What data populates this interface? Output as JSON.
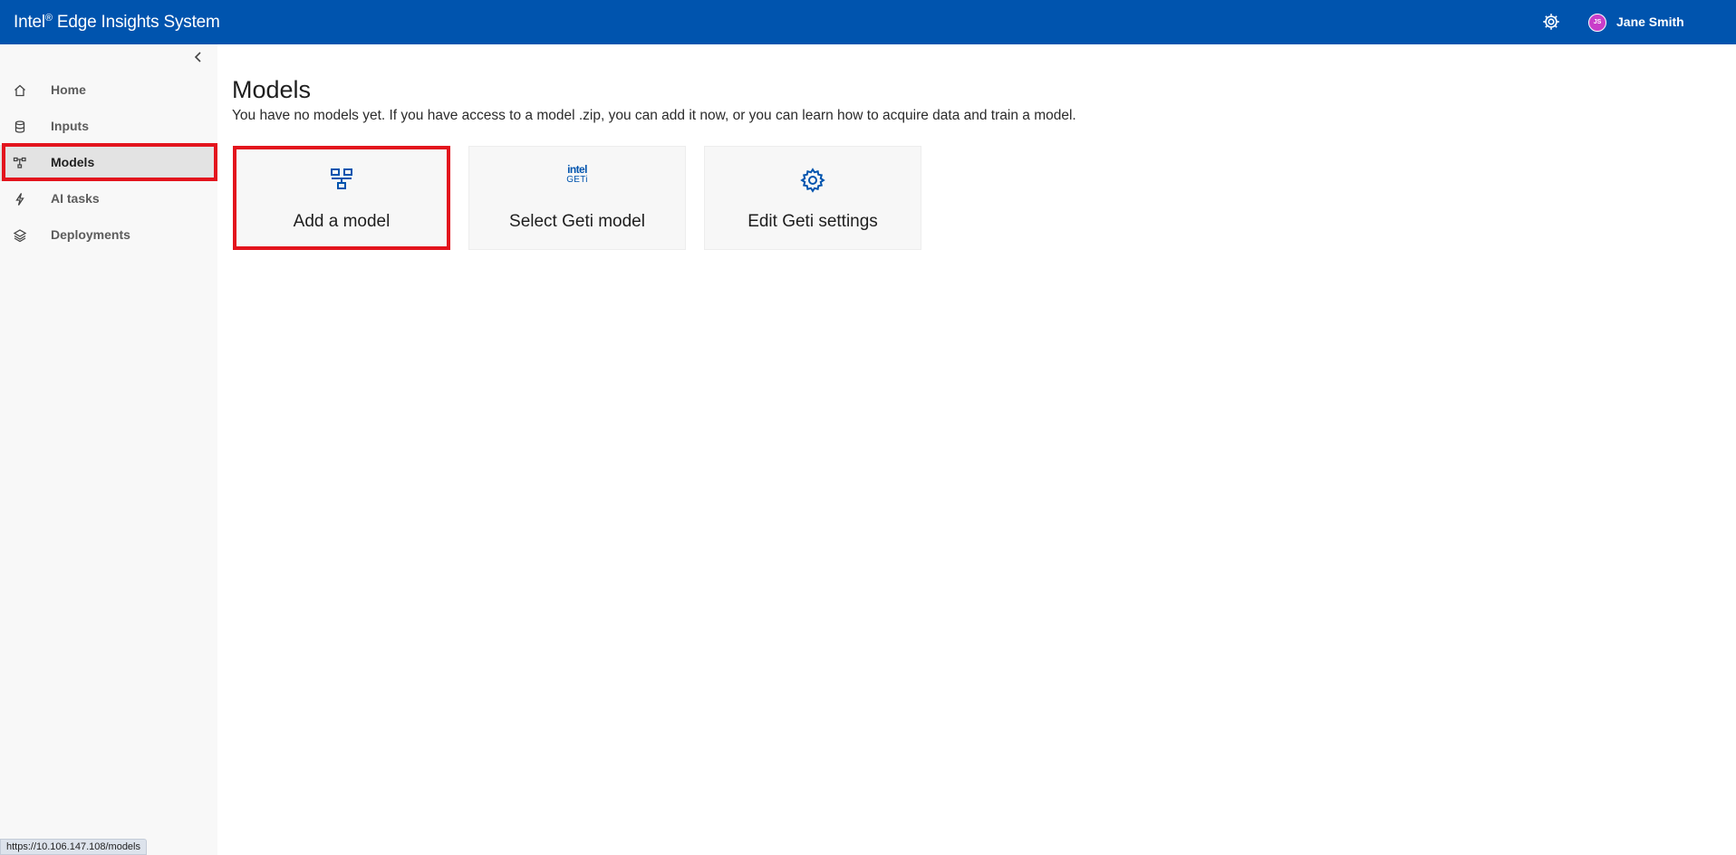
{
  "header": {
    "app_title": "Intel",
    "app_title_mark": "®",
    "app_title_rest": " Edge Insights System",
    "settings_icon": "gear-icon",
    "user": {
      "initials": "JS",
      "name": "Jane Smith",
      "avatar_color": "#c93ec9"
    },
    "bar_color": "#0054ae"
  },
  "sidebar": {
    "collapse_icon": "chevron-left-icon",
    "items": [
      {
        "label": "Home",
        "icon": "home-icon",
        "active": false
      },
      {
        "label": "Inputs",
        "icon": "database-icon",
        "active": false
      },
      {
        "label": "Models",
        "icon": "model-network-icon",
        "active": true
      },
      {
        "label": "AI tasks",
        "icon": "lightning-icon",
        "active": false
      },
      {
        "label": "Deployments",
        "icon": "layers-icon",
        "active": false
      }
    ]
  },
  "main": {
    "title": "Models",
    "description": "You have no models yet. If you have access to a model .zip, you can add it now, or you can learn how to acquire data and train a model.",
    "cards": [
      {
        "label": "Add a model",
        "icon": "add-model-icon"
      },
      {
        "label": "Select Geti model",
        "icon": "intel-geti-logo",
        "logo_line1": "intel",
        "logo_line2": "GETi"
      },
      {
        "label": "Edit Geti settings",
        "icon": "gear-icon"
      }
    ]
  },
  "status_bar": {
    "url": "https://10.106.147.108/models"
  },
  "colors": {
    "highlight": "#e3141d",
    "accent": "#0054ae"
  }
}
